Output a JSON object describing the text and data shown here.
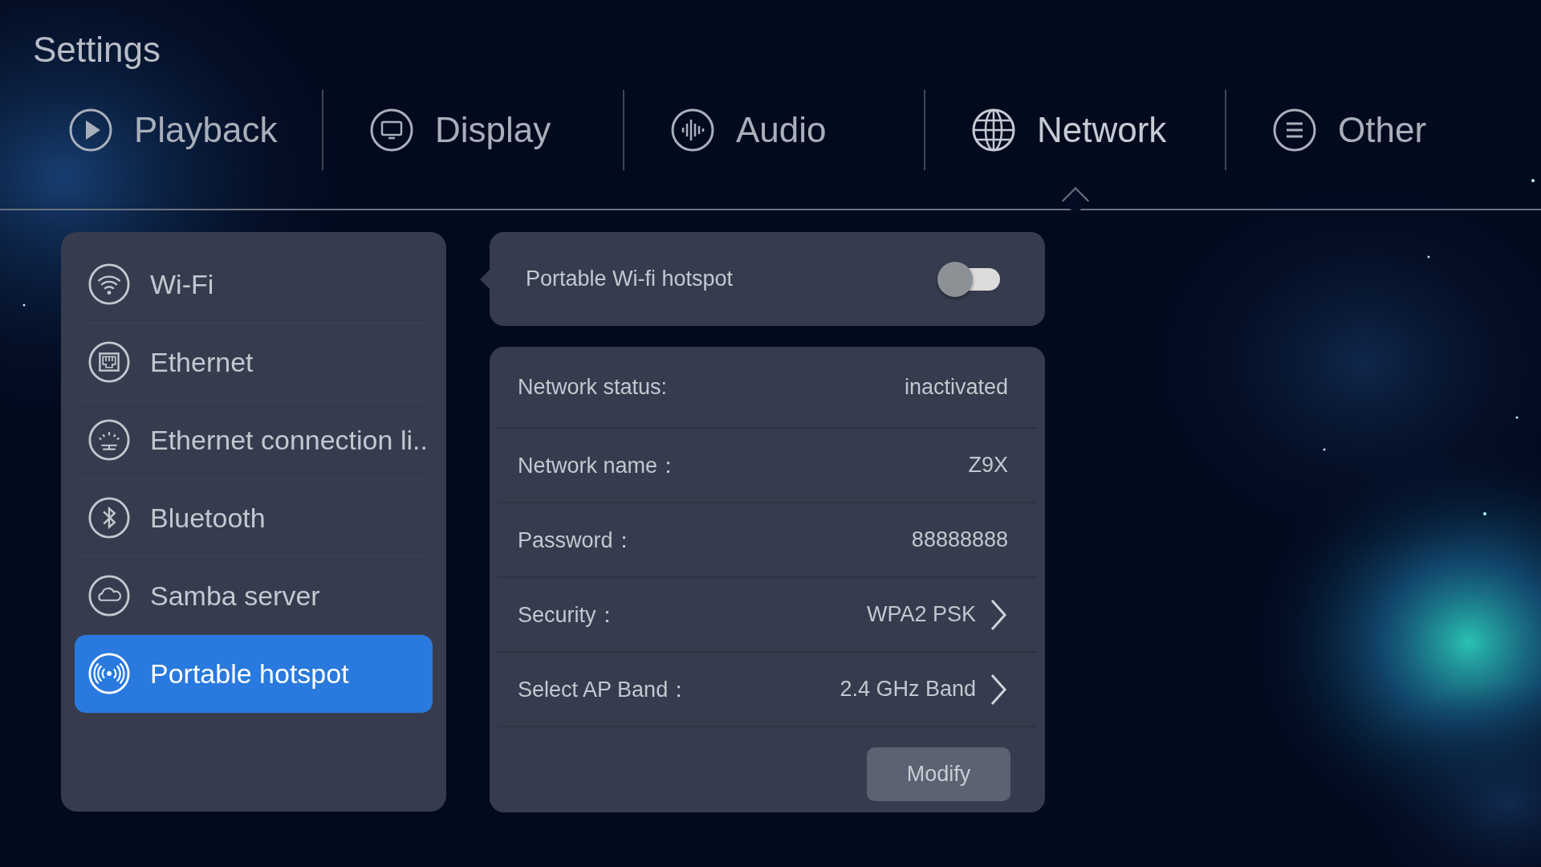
{
  "window": {
    "title": "Settings"
  },
  "tabs": [
    {
      "label": "Playback",
      "kind": "play",
      "selected": false
    },
    {
      "label": "Display",
      "kind": "monitor",
      "selected": false
    },
    {
      "label": "Audio",
      "kind": "audio",
      "selected": false
    },
    {
      "label": "Network",
      "kind": "globe",
      "selected": true
    },
    {
      "label": "Other",
      "kind": "menu",
      "selected": false
    }
  ],
  "sidebar": {
    "items": [
      {
        "label": "Wi-Fi",
        "kind": "wifi",
        "selected": false
      },
      {
        "label": "Ethernet",
        "kind": "ethernet",
        "selected": false
      },
      {
        "label": "Ethernet connection li..",
        "kind": "light",
        "selected": false
      },
      {
        "label": "Bluetooth",
        "kind": "bluetooth",
        "selected": false
      },
      {
        "label": "Samba server",
        "kind": "cloud",
        "selected": false
      },
      {
        "label": "Portable hotspot",
        "kind": "hotspot",
        "selected": true
      }
    ]
  },
  "hotspot_toggle": {
    "label": "Portable Wi-fi hotspot",
    "on": false
  },
  "details": {
    "rows": [
      {
        "label": "Network status:",
        "value": "inactivated",
        "kind": "plain"
      },
      {
        "label": "Network name：",
        "value": "Z9X",
        "kind": "plain"
      },
      {
        "label": "Password：",
        "value": "88888888",
        "kind": "plain"
      },
      {
        "label": "Security：",
        "value": "WPA2 PSK",
        "kind": "link"
      },
      {
        "label": "Select AP Band：",
        "value": "2.4 GHz Band",
        "kind": "link"
      }
    ],
    "button": "Modify"
  }
}
